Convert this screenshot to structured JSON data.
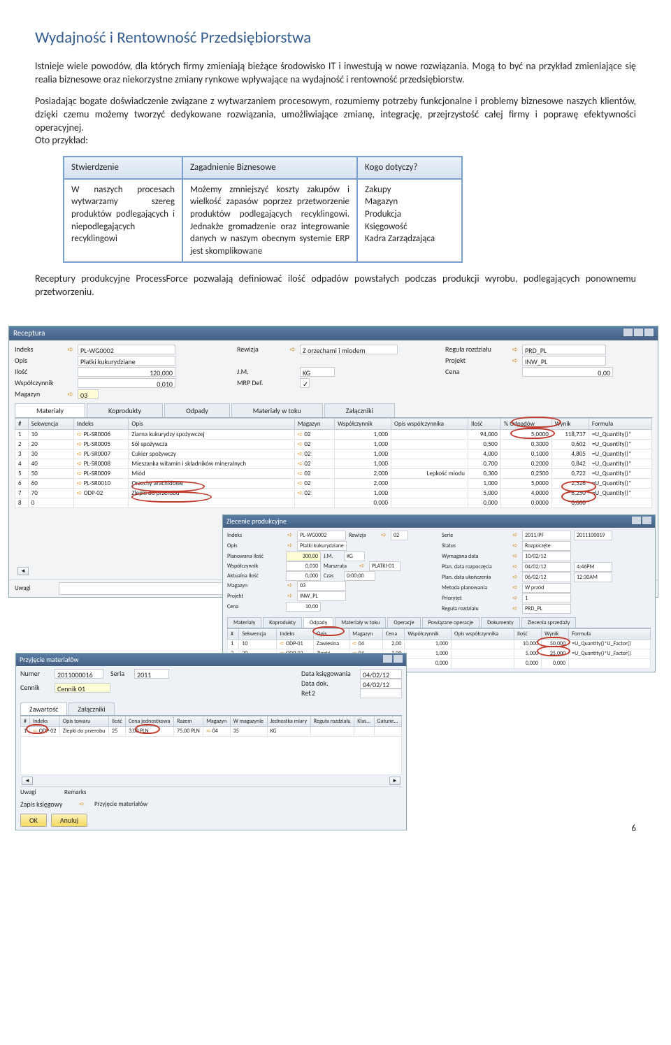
{
  "page": {
    "title": "Wydajność i Rentowność Przedsiębiorstwa",
    "p1": "Istnieje wiele powodów, dla których firmy zmieniają bieżące środowisko IT i inwestują w nowe rozwiązania. Mogą  to być na przykład zmieniające się realia biznesowe oraz niekorzystne zmiany rynkowe wpływające na wydajność i rentowność przedsiębiorstw.",
    "p2": "Posiadając bogate doświadczenie związane z wytwarzaniem procesowym, rozumiemy potrzeby funkcjonalne i problemy  biznesowe naszych klientów, dzięki czemu możemy tworzyć dedykowane rozwiązania, umożliwiające zmianę, integrację, przejrzystość całej firmy i poprawę efektywności operacyjnej.",
    "p2b": "Oto przykład:",
    "p3": "Receptury produkcyjne ProcessForce pozwalają definiować ilość  odpadów powstałych podczas produkcji wyrobu, podlegających ponownemu przetworzeniu.",
    "page_number": "6"
  },
  "bizTable": {
    "headers": [
      "Stwierdzenie",
      "Zagadnienie  Biznesowe",
      "Kogo dotyczy?"
    ],
    "row": {
      "c1": "W naszych procesach wytwarzamy szereg produktów podlegających i niepodlegających recyklingowi",
      "c2": "Możemy zmniejszyć koszty zakupów i wielkość zapasów poprzez przetworzenie produktów podlegających recyklingowi. Jednakże gromadzenie oraz integrowanie danych w naszym obecnym systemie ERP jest skomplikowane",
      "c3": "Zakupy\nMagazyn\nProdukcja\nKsięgowość\nKadra Zarządzająca"
    }
  },
  "receptura": {
    "title": "Receptura",
    "fields": {
      "indeks_l": "Indeks",
      "indeks_v": "PL-WG0002",
      "rewizja_l": "Rewizja",
      "rewizja_v": "Z orzechami i miodem",
      "regula_l": "Reguła rozdziału",
      "regula_v": "PRD_PL",
      "opis_l": "Opis",
      "opis_v": "Płatki kukurydziane",
      "projekt_l": "Projekt",
      "projekt_v": "INW_PL",
      "ilosc_l": "Ilość",
      "ilosc_v": "120,000",
      "jm_l": "J.M.",
      "jm_v": "KG",
      "cena_l": "Cena",
      "cena_v": "0,00",
      "wspol_l": "Współczynnik",
      "wspol_v": "0,010",
      "mrp_l": "MRP Def.",
      "magazyn_l": "Magazyn",
      "magazyn_v": "03"
    },
    "tabs": [
      "Materiały",
      "Koprodukty",
      "Odpady",
      "Materiały w toku",
      "Załączniki"
    ],
    "cols": [
      "#",
      "Sekwencja",
      "Indeks",
      "Opis",
      "Magazyn",
      "Współczynnik",
      "Opis współczynnika",
      "Ilość",
      "% Odpadów",
      "Wynik",
      "Formuła"
    ],
    "rows": [
      [
        "1",
        "10",
        "PL-SR0006",
        "Ziarna kukurydzy spożywczej",
        "02",
        "1,000",
        "",
        "94,000",
        "5,0000",
        "118,737",
        "=U_Quantity()*"
      ],
      [
        "2",
        "20",
        "PL-SR0005",
        "Sól spożywcza",
        "02",
        "1,000",
        "",
        "0,500",
        "0,3000",
        "0,602",
        "=U_Quantity()*"
      ],
      [
        "3",
        "30",
        "PL-SR0007",
        "Cukier spożywczy",
        "02",
        "1,000",
        "",
        "4,000",
        "0,1000",
        "4,805",
        "=U_Quantity()*"
      ],
      [
        "4",
        "40",
        "PL-SR0008",
        "Mieszanka witamin i składników mineralnych",
        "02",
        "1,000",
        "",
        "0,700",
        "0,2000",
        "0,842",
        "=U_Quantity()*"
      ],
      [
        "5",
        "50",
        "PL-SR0009",
        "Miód",
        "02",
        "2,000",
        "Lepkość miodu",
        "0,300",
        "0,2500",
        "0,722",
        "=U_Quantity()*"
      ],
      [
        "6",
        "60",
        "PL-SR0010",
        "Orzechy arachidowe",
        "02",
        "2,000",
        "",
        "1,000",
        "5,0000",
        "2,526",
        "=U_Quantity()*"
      ],
      [
        "7",
        "70",
        "ODP-02",
        "Zlepki do przerobu",
        "02",
        "1,000",
        "",
        "5,000",
        "4,0000",
        "6,250",
        "=U_Quantity()*"
      ],
      [
        "8",
        "0",
        "",
        "",
        "",
        "0,000",
        "",
        "0,000",
        "0,0000",
        "0,000",
        ""
      ]
    ],
    "uwagi_l": "Uwagi"
  },
  "zlecenie": {
    "title": "Zlecenie produkcyjne",
    "left": {
      "indeks": [
        "Indeks",
        "PL-WG0002"
      ],
      "rewizja": [
        "Rewizja",
        "02"
      ],
      "opis": [
        "Opis",
        "Płatki kukurydziane"
      ],
      "plan": [
        "Planowana ilość",
        "300,00"
      ],
      "jm": [
        "J.M.",
        "KG"
      ],
      "wspol": [
        "Współczynnik",
        "0,010"
      ],
      "marszruta": [
        "Marszruta",
        "PLATKI-01"
      ],
      "akt": [
        "Aktualna ilość",
        "0,000"
      ],
      "czas": [
        "Czas",
        "0:00:00"
      ],
      "mag": [
        "Magazyn",
        "03"
      ],
      "proj": [
        "Projekt",
        "INW_PL"
      ],
      "cena": [
        "Cena",
        "10,00"
      ]
    },
    "right": {
      "serie": [
        "Serie",
        "2011/PF",
        "2011100019"
      ],
      "status": [
        "Status",
        "Rozpoczęte"
      ],
      "wym": [
        "Wymagana data",
        "10/02/12"
      ],
      "plr": [
        "Plan. data rozpoczęcia",
        "04/02/12",
        "4:46PM"
      ],
      "plu": [
        "Plan. data ukończenia",
        "06/02/12",
        "12:30AM"
      ],
      "met": [
        "Metoda planowania",
        "W przód"
      ],
      "pri": [
        "Priorytet",
        "1"
      ],
      "reg": [
        "Reguła rozdziału",
        "PRD_PL"
      ]
    },
    "tabs": [
      "Materiały",
      "Koprodukty",
      "Odpady",
      "Materiały w toku",
      "Operacje",
      "Powiązane operacje",
      "Dokumenty",
      "Zlecenia sprzedaży"
    ],
    "cols": [
      "#",
      "Sekwencja",
      "Indeks",
      "Opis",
      "Magazyn",
      "Cena",
      "Współczynnik",
      "Opis współczynnika",
      "Ilość",
      "Wynik",
      "Formuła"
    ],
    "rows": [
      [
        "1",
        "10",
        "ODP-01",
        "Zawiesina",
        "04",
        "2,00",
        "1,000",
        "",
        "10,000",
        "50,000",
        "=U_Quantity()*U_Factor()"
      ],
      [
        "2",
        "20",
        "ODP-02",
        "Zlepki",
        "04",
        "3,00",
        "1,000",
        "",
        "5,000",
        "25,000",
        "=U_Quantity()*U_Factor()"
      ],
      [
        "",
        "",
        "",
        "",
        "",
        "0,00",
        "0,000",
        "",
        "0,000",
        "0,000",
        ""
      ]
    ]
  },
  "recv": {
    "title": "Przyjęcie materiałów",
    "fields": {
      "numer": [
        "Numer",
        "2011000016"
      ],
      "seria": [
        "Seria",
        "2011"
      ],
      "data_ks": [
        "Data księgowania",
        "04/02/12"
      ],
      "data_dok": [
        "Data dok.",
        "04/02/12"
      ],
      "ref": [
        "Ref.2",
        ""
      ],
      "cennik": [
        "Cennik",
        "Cennik 01"
      ]
    },
    "tabs": [
      "Zawartość",
      "Załączniki"
    ],
    "cols": [
      "#",
      "Indeks",
      "Opis towaru",
      "Ilość",
      "Cena jednostkowa",
      "Razem",
      "Magazyn",
      "W magazynie",
      "Jednostka miary",
      "Reguła rozdziału",
      "Klas...",
      "Gatune..."
    ],
    "row": [
      "1",
      "ODP-02",
      "Zlepki do przerobu",
      "25",
      "3,00 PLN",
      "75,00 PLN",
      "04",
      "35",
      "KG",
      "",
      "",
      ""
    ],
    "uwagi_l": "Uwagi",
    "remarks": "Remarks",
    "footer_l": "Zapis księgowy",
    "footer_r": "Przyjęcie materiałów",
    "btn_ok": "OK",
    "btn_anuluj": "Anuluj"
  }
}
